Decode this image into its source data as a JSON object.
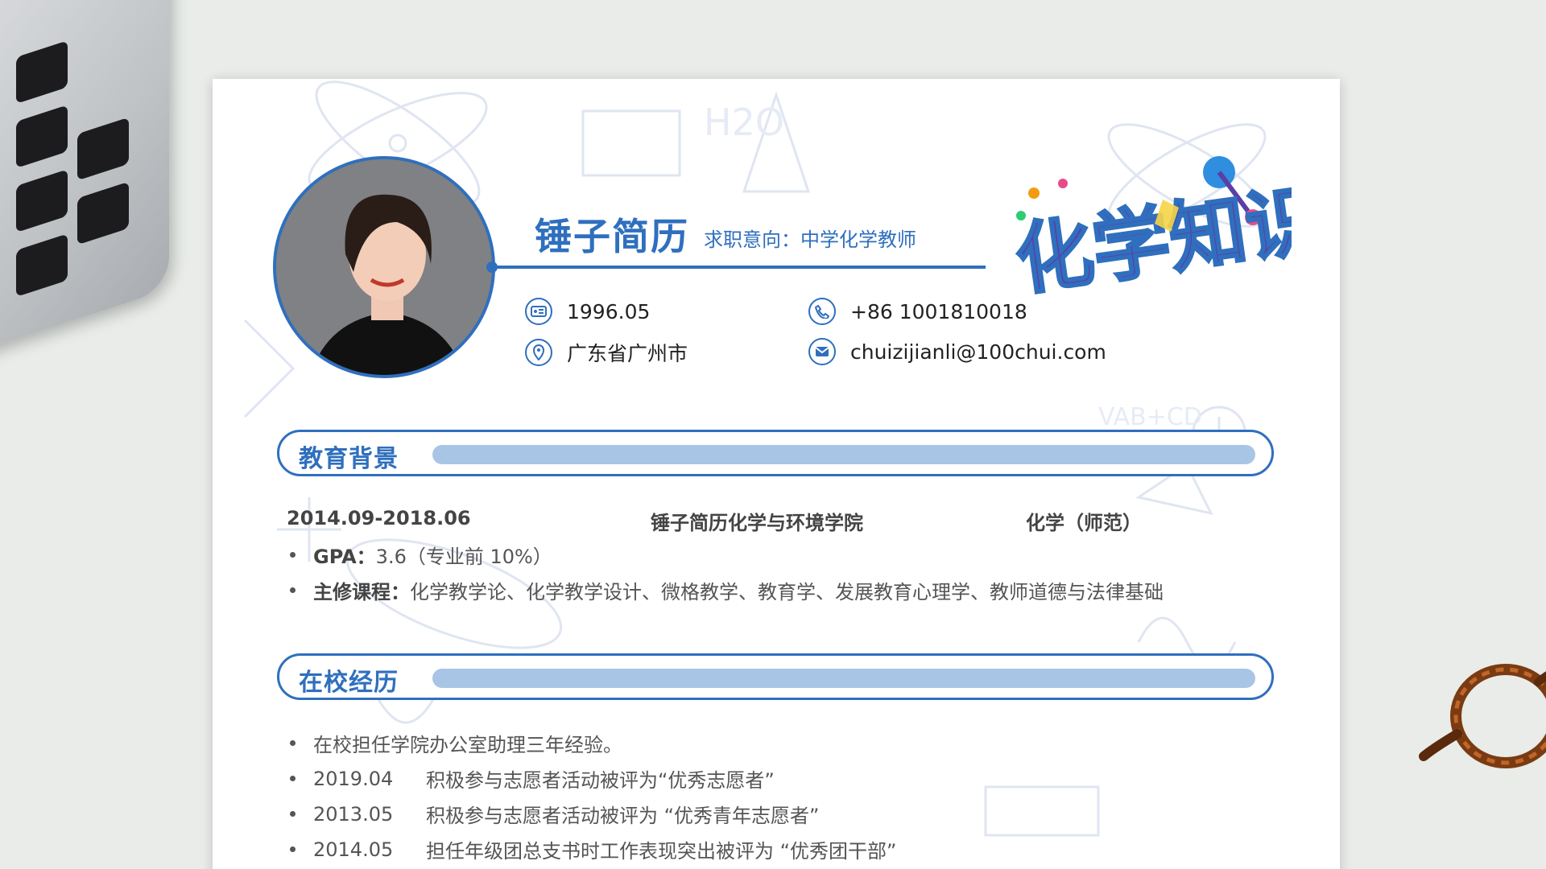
{
  "resume": {
    "name": "锤子简历",
    "intent": "求职意向：中学化学教师",
    "logo_text": "化学知识",
    "contacts": {
      "birth": "1996.05",
      "phone": "+86 1001810018",
      "location": "广东省广州市",
      "email": "chuizijianli@100chui.com"
    }
  },
  "education": {
    "heading": "教育背景",
    "period": "2014.09-2018.06",
    "school": "锤子简历化学与环境学院",
    "major": "化学（师范）",
    "gpa_label": "GPA：",
    "gpa_value": "3.6（专业前 10%）",
    "courses_label": "主修课程：",
    "courses_value": "化学教学论、化学教学设计、微格教学、教育学、发展教育心理学、教师道德与法律基础"
  },
  "campus": {
    "heading": "在校经历",
    "items": [
      {
        "date": "",
        "text": "在校担任学院办公室助理三年经验。"
      },
      {
        "date": "2019.04",
        "text": "积极参与志愿者活动被评为“优秀志愿者”"
      },
      {
        "date": "2013.05",
        "text": "积极参与志愿者活动被评为 “优秀青年志愿者”"
      },
      {
        "date": "2014.05",
        "text": "担任年级团总支书时工作表现突出被评为 “优秀团干部”"
      }
    ]
  },
  "colors": {
    "accent": "#2f6fbe",
    "bar": "#a9c5e6",
    "logo_purple": "#5b3fa6"
  }
}
